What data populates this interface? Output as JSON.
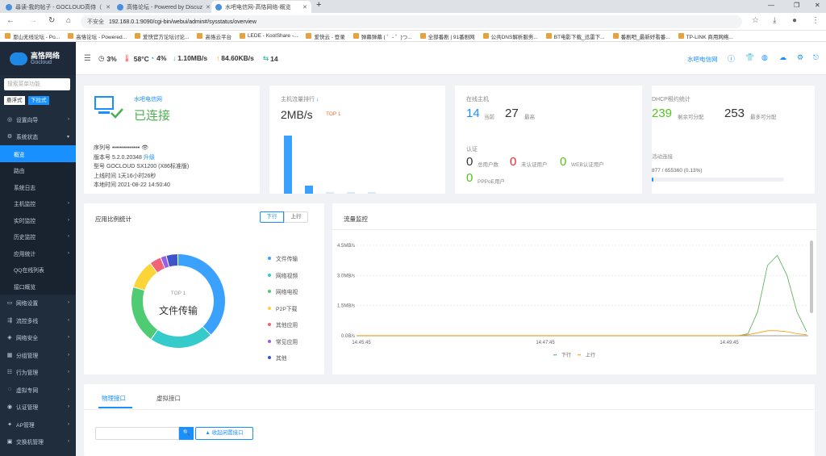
{
  "tabs": [
    {
      "title": "尋读-我的帖子 - GOCLOUD高侍（",
      "active": false
    },
    {
      "title": "高恪论坛 - Powered by Discuz!",
      "active": false
    },
    {
      "title": "水吧电信网-高恪网络-概览",
      "active": true
    }
  ],
  "new_tab": "+",
  "window": {
    "min": "—",
    "restore": "❐",
    "close": "✕"
  },
  "address": {
    "warning": "不安全",
    "url": "192.168.0.1:9090/cgi-bin/webui/admin#/sysstatus/overview"
  },
  "bookmarks": [
    "恩山无线论坛 - Po...",
    "高恪论坛 - Powered...",
    "爱快官方论坛讨论...",
    "高恪云平台",
    "LEDE - KoolShare -...",
    "爱快云 - 登录",
    "弹幕弹幕 ( ゜- ゜)つ...",
    "全部番剧 | 91番剧网",
    "公共DNS解析服务...",
    "BT电影下载_迅雷下...",
    "番剧吧_最新好看番...",
    "TP-LINK 商用网络..."
  ],
  "app": {
    "logo_cn": "高恪网络",
    "logo_en": "Gocloud",
    "stats": {
      "cpu": "3%",
      "temp": "58°C",
      "mem": "4%",
      "down": "1.10MB/s",
      "up": "84.60KB/s",
      "conns": "14"
    },
    "site_name": "水吧电信网"
  },
  "sidebar": {
    "search_placeholder": "搜索菜单功能",
    "view_float": "悬浮式",
    "view_dropdown": "下拉式",
    "items": [
      {
        "label": "设置向导",
        "type": "top"
      },
      {
        "label": "系统状态",
        "type": "top",
        "open": true
      },
      {
        "label": "概览",
        "type": "sub",
        "active": true
      },
      {
        "label": "路由",
        "type": "sub"
      },
      {
        "label": "系统日志",
        "type": "sub"
      },
      {
        "label": "主机监控",
        "type": "sub",
        "arrow": true
      },
      {
        "label": "实时监控",
        "type": "sub",
        "arrow": true
      },
      {
        "label": "历史监控",
        "type": "sub",
        "arrow": true
      },
      {
        "label": "应用统计",
        "type": "sub",
        "arrow": true
      },
      {
        "label": "QQ在线列表",
        "type": "sub"
      },
      {
        "label": "接口概览",
        "type": "sub"
      },
      {
        "label": "网络设置",
        "type": "top"
      },
      {
        "label": "流控多线",
        "type": "top"
      },
      {
        "label": "网络安全",
        "type": "top"
      },
      {
        "label": "分组管理",
        "type": "top"
      },
      {
        "label": "行为管理",
        "type": "top"
      },
      {
        "label": "虚拟专网",
        "type": "top"
      },
      {
        "label": "认证管理",
        "type": "top"
      },
      {
        "label": "AP管理",
        "type": "top"
      },
      {
        "label": "交换机管理",
        "type": "top"
      }
    ]
  },
  "device": {
    "name": "水吧电信网",
    "status": "已连接",
    "serial_label": "序列号",
    "serial_value": "••••••••••••••",
    "version_label": "版本号",
    "version_value": "5.2.0.20348",
    "upgrade": "升级",
    "model_label": "型号",
    "model_value": "GOCLOUD SX1200 (X86标准版)",
    "uptime_label": "上线时间",
    "uptime_value": "1天16小时26秒",
    "time_label": "本地时间",
    "time_value": "2021-08-22 14:50:40"
  },
  "traffic_rank": {
    "title": "主机流量排行",
    "value": "2MB/s",
    "badge": "TOP 1"
  },
  "hosts": {
    "title": "在线主机",
    "current": "14",
    "current_label": "当前",
    "max": "27",
    "max_label": "最高",
    "auth_title": "认证",
    "total": "0",
    "total_label": "总用户数",
    "unauth": "0",
    "unauth_label": "未认证用户",
    "web": "0",
    "web_label": "WEB认证用户",
    "pppoe": "0",
    "pppoe_label": "PPPoE用户"
  },
  "dhcp": {
    "title": "DHCP租约统计",
    "remain": "239",
    "remain_label": "剩余可分配",
    "max": "253",
    "max_label": "最多可分配",
    "active_title": "活动连接",
    "active_value": "877 / 655360 (0.13%)",
    "active_fraction": 0.0013
  },
  "app_stats": {
    "title": "应用比例统计",
    "tab_down": "下行",
    "tab_up": "上行",
    "center_top": "TOP 1",
    "center_label": "文件传输",
    "legend": [
      {
        "name": "文件传输",
        "color": "#3ba1ff",
        "value": 38
      },
      {
        "name": "网络视频",
        "color": "#36cbcb",
        "value": 22
      },
      {
        "name": "网络电视",
        "color": "#4ecb73",
        "value": 20
      },
      {
        "name": "P2P下载",
        "color": "#fbd437",
        "value": 10
      },
      {
        "name": "其他应用",
        "color": "#f2637b",
        "value": 4
      },
      {
        "name": "常见应用",
        "color": "#975fe5",
        "value": 2
      },
      {
        "name": "其他",
        "color": "#3b55c8",
        "value": 4
      }
    ]
  },
  "traffic_monitor": {
    "title": "流量监控"
  },
  "chart_data": {
    "type": "line",
    "ylim": [
      0,
      4.5
    ],
    "y_ticks": [
      "4.5MB/s",
      "3.0MB/s",
      "1.5MB/s",
      "0.0B/s"
    ],
    "x_ticks": [
      "14:45:45",
      "14:47:45",
      "14:49:45"
    ],
    "series": [
      {
        "name": "下行",
        "color": "#4caf50",
        "values": [
          0,
          0,
          0,
          0,
          0,
          0,
          0,
          0,
          0,
          0,
          0,
          0,
          0,
          0,
          0,
          0,
          0,
          0,
          0,
          0,
          0,
          0,
          0,
          0,
          0,
          0,
          0,
          0,
          0,
          0,
          0,
          0,
          0,
          0,
          0,
          0,
          0,
          0,
          0,
          0,
          0.1,
          1.2,
          3.5,
          4.0,
          3.0,
          1.2,
          0.2
        ]
      },
      {
        "name": "上行",
        "color": "#ff9800",
        "values": [
          0.01,
          0.01,
          0.01,
          0.01,
          0.01,
          0.01,
          0.01,
          0.01,
          0.01,
          0.01,
          0.01,
          0.01,
          0.01,
          0.01,
          0.01,
          0.01,
          0.01,
          0.01,
          0.01,
          0.01,
          0.01,
          0.01,
          0.01,
          0.01,
          0.01,
          0.01,
          0.01,
          0.01,
          0.01,
          0.01,
          0.01,
          0.01,
          0.01,
          0.01,
          0.01,
          0.01,
          0.01,
          0.01,
          0.01,
          0.01,
          0.05,
          0.15,
          0.25,
          0.25,
          0.2,
          0.1,
          0.05
        ]
      }
    ]
  },
  "interfaces": {
    "tab_physical": "物理接口",
    "tab_virtual": "虚拟接口",
    "search_button": "🔍",
    "expand_button": "收起闲置接口"
  }
}
